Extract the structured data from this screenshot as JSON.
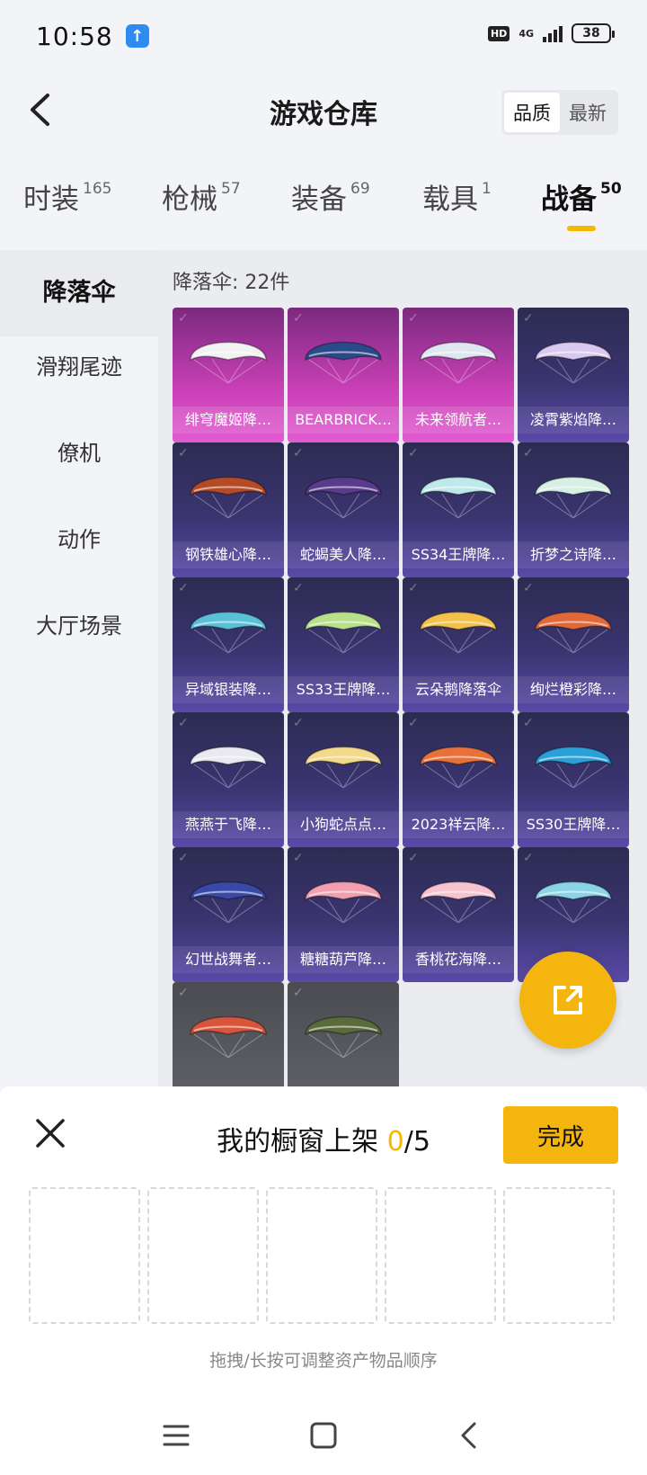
{
  "status_bar": {
    "time": "10:58",
    "network": "4G",
    "hd": "HD",
    "battery": "38"
  },
  "header": {
    "title": "游戏仓库",
    "sort_options": [
      "品质",
      "最新"
    ]
  },
  "categories": [
    {
      "label": "时装",
      "count": "165"
    },
    {
      "label": "枪械",
      "count": "57"
    },
    {
      "label": "装备",
      "count": "69"
    },
    {
      "label": "载具",
      "count": "1"
    },
    {
      "label": "战备",
      "count": "50"
    }
  ],
  "sidebar": {
    "items": [
      "降落伞",
      "滑翔尾迹",
      "僚机",
      "动作",
      "大厅场景"
    ]
  },
  "content": {
    "count_label": "降落伞: 22件",
    "items": [
      {
        "name": "绯穹魔姬降…",
        "tier": "pink",
        "color": "#f2f2f2"
      },
      {
        "name": "BEARBRICK…",
        "tier": "pink",
        "color": "#2a4a8a"
      },
      {
        "name": "未来领航者…",
        "tier": "pink",
        "color": "#dfe6f0"
      },
      {
        "name": "凌霄紫焰降…",
        "tier": "purple",
        "color": "#d9c9f0"
      },
      {
        "name": "钢铁雄心降…",
        "tier": "purple",
        "color": "#b54a26"
      },
      {
        "name": "蛇蝎美人降…",
        "tier": "purple",
        "color": "#5a3a8a"
      },
      {
        "name": "SS34王牌降…",
        "tier": "purple",
        "color": "#bfe8ea"
      },
      {
        "name": "折梦之诗降…",
        "tier": "purple",
        "color": "#d7efe4"
      },
      {
        "name": "异域银装降…",
        "tier": "purple",
        "color": "#5ac0d8"
      },
      {
        "name": "SS33王牌降…",
        "tier": "purple",
        "color": "#b8e08a"
      },
      {
        "name": "云朵鹅降落伞",
        "tier": "purple",
        "color": "#f2c24a"
      },
      {
        "name": "绚烂橙彩降…",
        "tier": "purple",
        "color": "#e0693a"
      },
      {
        "name": "燕燕于飞降…",
        "tier": "purple",
        "color": "#e9e9f0"
      },
      {
        "name": "小狗蛇点点…",
        "tier": "purple",
        "color": "#f3d98a"
      },
      {
        "name": "2023祥云降…",
        "tier": "purple",
        "color": "#e8713a"
      },
      {
        "name": "SS30王牌降…",
        "tier": "purple",
        "color": "#2aa0d8"
      },
      {
        "name": "幻世战舞者…",
        "tier": "purple",
        "color": "#3a48a8"
      },
      {
        "name": "糖糖葫芦降…",
        "tier": "purple",
        "color": "#f2a0b0"
      },
      {
        "name": "香桃花海降…",
        "tier": "purple",
        "color": "#f7c3cf"
      },
      {
        "name": "",
        "tier": "purple",
        "color": "#8ad4e6"
      },
      {
        "name": "",
        "tier": "grey",
        "color": "#d8543a"
      },
      {
        "name": "",
        "tier": "grey",
        "color": "#5a6a3a"
      }
    ]
  },
  "sheet": {
    "title_prefix": "我的橱窗上架 ",
    "title_count": "0",
    "title_total": "/5",
    "done_label": "完成",
    "hint": "拖拽/长按可调整资产物品顺序"
  }
}
